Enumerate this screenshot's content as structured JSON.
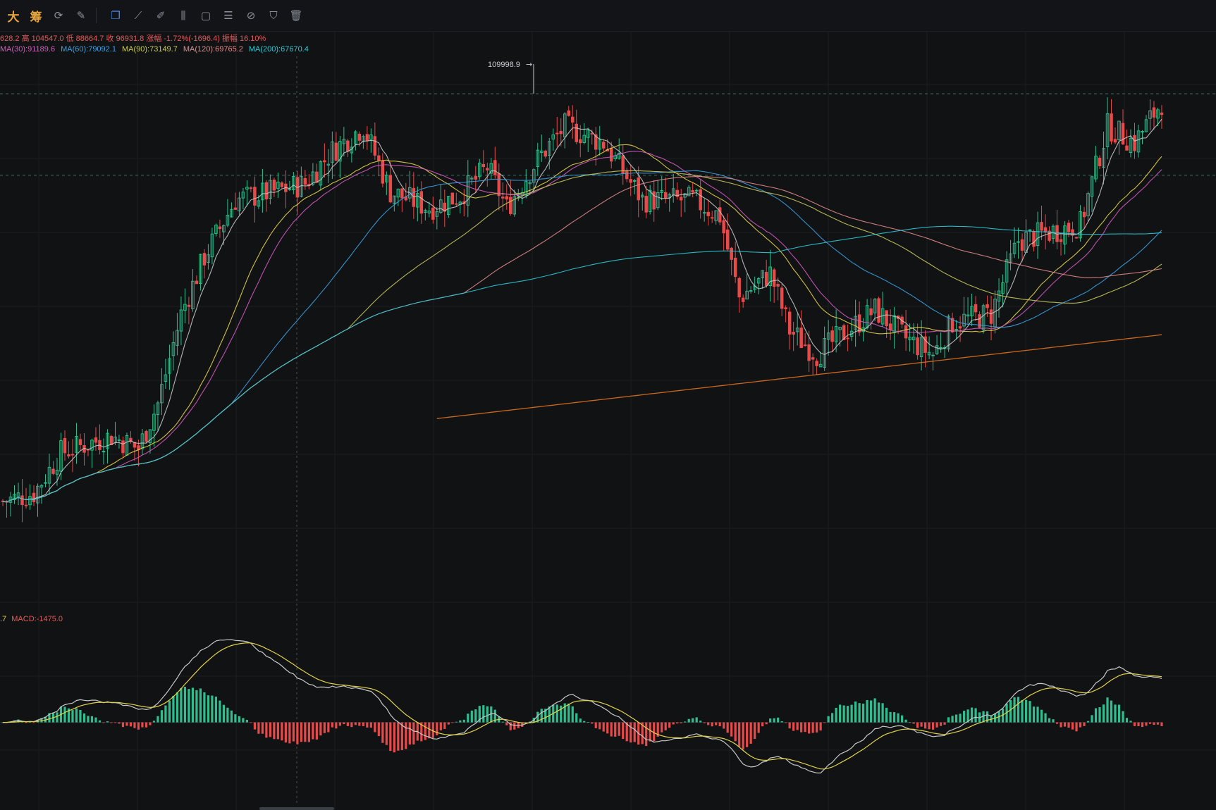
{
  "toolbar": {
    "items": [
      {
        "name": "big-text-tool",
        "label": "大",
        "kind": "cn"
      },
      {
        "name": "chip-tool",
        "label": "筹",
        "kind": "cn"
      },
      {
        "name": "refresh-icon",
        "label": "⟳",
        "kind": "icon"
      },
      {
        "name": "draw-settings-icon",
        "label": "✎",
        "kind": "icon"
      },
      {
        "name": "copy-icon",
        "label": "❐",
        "kind": "icon",
        "active": true
      },
      {
        "name": "ruler-icon",
        "label": "⟋",
        "kind": "icon"
      },
      {
        "name": "pen-icon",
        "label": "✐",
        "kind": "icon"
      },
      {
        "name": "candles-icon",
        "label": "⫼",
        "kind": "icon"
      },
      {
        "name": "lock-icon",
        "label": "▢",
        "kind": "icon"
      },
      {
        "name": "note-icon",
        "label": "☰",
        "kind": "icon"
      },
      {
        "name": "magnet-icon",
        "label": "⊘",
        "kind": "icon"
      },
      {
        "name": "filter-icon",
        "label": "⛉",
        "kind": "icon"
      },
      {
        "name": "trash-icon",
        "label": "🗑",
        "kind": "icon"
      }
    ]
  },
  "ohlc_text": "628.2 高 104547.0 低 88664.7 收 96931.8 涨幅 -1.72%(-1696.4) 振幅 16.10%",
  "ma_legend": [
    {
      "label": "MA(30):91189.6",
      "color": "#d35bc0"
    },
    {
      "label": "MA(60):79092.1",
      "color": "#3aa0e0"
    },
    {
      "label": "MA(90):73149.7",
      "color": "#c9c95a"
    },
    {
      "label": "MA(120):69765.2",
      "color": "#e08a8a"
    },
    {
      "label": "MA(200):67670.4",
      "color": "#2cc9d6"
    }
  ],
  "macd_legend": {
    "prefix": ".7",
    "label": "MACD:-1475.0",
    "color": "#e35b5b"
  },
  "colors": {
    "up": "#2fbf8e",
    "down": "#e84a4a",
    "ma7": "#c8c8c8",
    "ma25": "#e3d34a",
    "ma30": "#d35bc0",
    "ma60": "#3aa0e0",
    "ma90": "#c9c95a",
    "ma120": "#e08a8a",
    "ma200": "#2cc9d6",
    "ma_orange": "#e0701f",
    "dif": "#c8c8c8",
    "dea": "#e3d34a",
    "background": "#111214",
    "grid": "#1b1d21"
  },
  "chart_data": {
    "type": "candlestick",
    "price_max_label": "109998.9",
    "price_range": [
      58000,
      112000
    ],
    "reference_levels": [
      109998.9,
      100000
    ],
    "candle_count": 300,
    "trend_anchors": [
      [
        0,
        60000
      ],
      [
        8,
        61000
      ],
      [
        15,
        66000
      ],
      [
        28,
        68000
      ],
      [
        35,
        66500
      ],
      [
        40,
        72000
      ],
      [
        46,
        83000
      ],
      [
        52,
        90000
      ],
      [
        60,
        97000
      ],
      [
        70,
        98000
      ],
      [
        78,
        99000
      ],
      [
        85,
        103000
      ],
      [
        93,
        106000
      ],
      [
        100,
        98000
      ],
      [
        110,
        96000
      ],
      [
        118,
        97500
      ],
      [
        125,
        101000
      ],
      [
        130,
        96000
      ],
      [
        138,
        102000
      ],
      [
        145,
        106000
      ],
      [
        155,
        104000
      ],
      [
        165,
        97000
      ],
      [
        178,
        97000
      ],
      [
        185,
        95000
      ],
      [
        190,
        85000
      ],
      [
        198,
        88000
      ],
      [
        203,
        81000
      ],
      [
        210,
        78000
      ],
      [
        218,
        81000
      ],
      [
        225,
        83500
      ],
      [
        233,
        80000
      ],
      [
        240,
        78000
      ],
      [
        245,
        82000
      ],
      [
        255,
        83000
      ],
      [
        262,
        92000
      ],
      [
        270,
        93000
      ],
      [
        278,
        94000
      ],
      [
        285,
        106000
      ],
      [
        292,
        104000
      ],
      [
        299,
        109000
      ]
    ],
    "moving_averages": [
      "MA(7)",
      "MA(25)",
      "MA(30)",
      "MA(60)",
      "MA(90)",
      "MA(120)",
      "MA(200)"
    ],
    "macd": {
      "label": "MACD",
      "value": -1475.0,
      "range": [
        -5500,
        7500
      ]
    }
  }
}
